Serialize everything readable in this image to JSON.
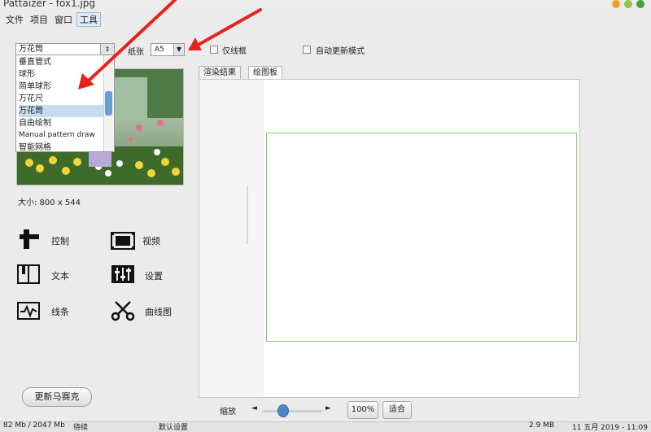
{
  "window": {
    "title": "Pattaizer - fox1.jpg"
  },
  "menu": {
    "items": [
      "文件",
      "项目",
      "窗口",
      "工具"
    ]
  },
  "left_panel": {
    "pattern_dropdown": "万花筒",
    "pattern_list": [
      "垂直管式",
      "球形",
      "简单球形",
      "万花尺",
      "万花筒",
      "自由绘制",
      "Manual pattern draw",
      "智能网格"
    ],
    "selected_pattern": "万花筒",
    "size_label": "大小: 800 x 544",
    "tools": [
      {
        "label": "控制",
        "icon": "control-icon"
      },
      {
        "label": "视频",
        "icon": "film-icon"
      },
      {
        "label": "文本",
        "icon": "book-icon"
      },
      {
        "label": "设置",
        "icon": "sliders-icon"
      },
      {
        "label": "线条",
        "icon": "pulse-icon"
      },
      {
        "label": "曲线图",
        "icon": "scissors-icon"
      }
    ],
    "update_button": "更新马赛克"
  },
  "toolbar": {
    "paper_label": "纸张",
    "paper_size": "A5",
    "checkbox_border_only": "仅线框",
    "checkbox_auto_update": "自动更新模式"
  },
  "tabs": [
    "渲染结果",
    "绘图板"
  ],
  "zoom": {
    "label": "缩放",
    "percent_button": "100%",
    "fit_button": "适合",
    "level": 0.35
  },
  "status": {
    "memory": "82 Mb / 2047 Mb",
    "state": "待续",
    "settings": "默认设置",
    "file_size": "2.9 MB",
    "datetime": "11 五月 2019 - 11:09"
  },
  "colors": {
    "annotation_arrow": "#e8231c",
    "canvas_frame": "#7cd27a",
    "selection": "#c7dcf3",
    "accent": "#4f86c6"
  }
}
